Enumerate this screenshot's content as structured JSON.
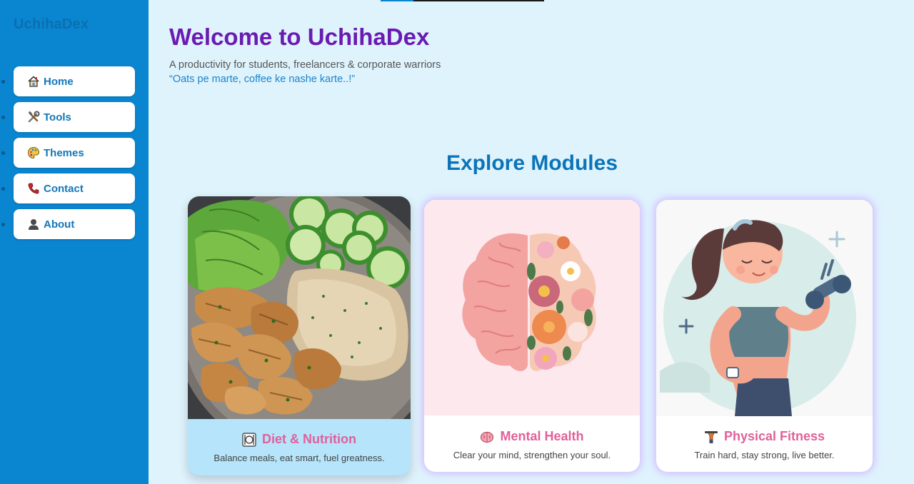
{
  "app": {
    "logo": "UchihaDex"
  },
  "sidebar": {
    "items": [
      {
        "label": "Home",
        "icon": "house-icon"
      },
      {
        "label": "Tools",
        "icon": "tools-icon"
      },
      {
        "label": "Themes",
        "icon": "palette-icon"
      },
      {
        "label": "Contact",
        "icon": "phone-icon"
      },
      {
        "label": "About",
        "icon": "person-icon"
      }
    ]
  },
  "progress": {
    "fill_fraction": 0.2
  },
  "header": {
    "title": "Welcome to UchihaDex",
    "subtitle": "A productivity for students, freelancers & corporate warriors",
    "quote": "“Oats pe marte, coffee ke nashe karte..!”"
  },
  "modules": {
    "heading": "Explore Modules",
    "cards": [
      {
        "title": "Diet & Nutrition",
        "description": "Balance meals, eat smart, fuel greatness.",
        "icon": "plate-icon"
      },
      {
        "title": "Mental Health",
        "description": "Clear your mind, strengthen your soul.",
        "icon": "brain-icon"
      },
      {
        "title": "Physical Fitness",
        "description": "Train hard, stay strong, live better.",
        "icon": "weightlifter-icon"
      }
    ]
  },
  "colors": {
    "sidebar_bg": "#0a86d1",
    "page_bg": "#dff3fd",
    "welcome": "#6a1bb3",
    "heading": "#0b74b8",
    "card_title": "#e0609a",
    "diet_card_bg": "#b5e4fb"
  }
}
